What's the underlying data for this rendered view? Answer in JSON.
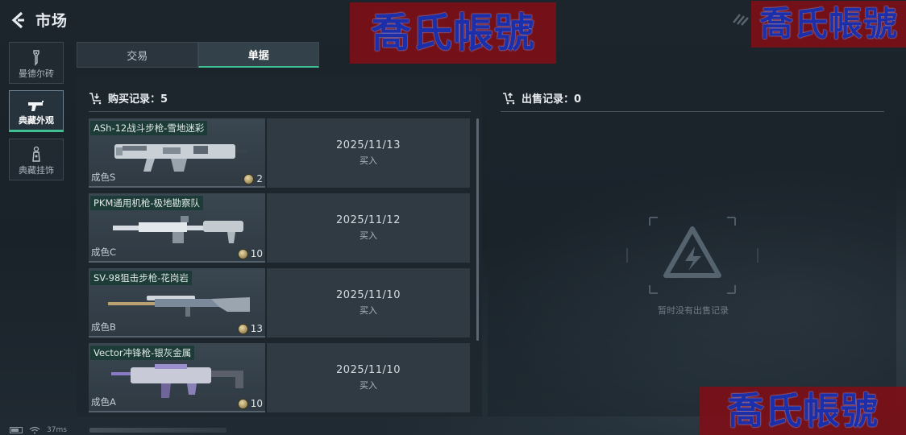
{
  "header": {
    "title": "市场"
  },
  "watermark": "喬氏帳號",
  "sidebar": {
    "items": [
      {
        "label": "曼德尔砖",
        "icon": "brick-icon",
        "active": false
      },
      {
        "label": "典藏外观",
        "icon": "pistol-icon",
        "active": true
      },
      {
        "label": "典藏挂饰",
        "icon": "charm-icon",
        "active": false
      }
    ]
  },
  "tabs": [
    {
      "label": "交易",
      "active": false
    },
    {
      "label": "单据",
      "active": true
    }
  ],
  "purchase": {
    "heading": "购买记录：5",
    "records": [
      {
        "name": "ASh-12战斗步枪-雪地迷彩",
        "grade": "成色S",
        "count": "2",
        "date": "2025/11/13",
        "action": "买入"
      },
      {
        "name": "PKM通用机枪-极地勘察队",
        "grade": "成色C",
        "count": "10",
        "date": "2025/11/12",
        "action": "买入"
      },
      {
        "name": "SV-98狙击步枪-花岗岩",
        "grade": "成色B",
        "count": "13",
        "date": "2025/11/10",
        "action": "买入"
      },
      {
        "name": "Vector冲锋枪-银灰金属",
        "grade": "成色A",
        "count": "10",
        "date": "2025/11/10",
        "action": "买入"
      }
    ]
  },
  "sale": {
    "heading": "出售记录：0",
    "empty_text": "暂时没有出售记录"
  },
  "status": {
    "ping": "37ms"
  },
  "colors": {
    "accent": "#3fbf92",
    "panel": "#2f3a43",
    "watermark_bg": "#800e16",
    "watermark_text": "#1c2fa8"
  }
}
